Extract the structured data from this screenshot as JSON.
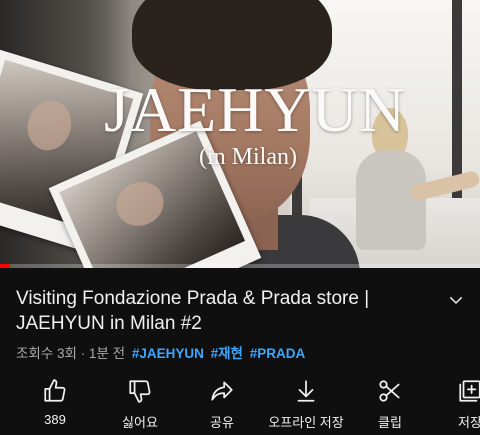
{
  "video": {
    "overlay_title": "JAEHYUN",
    "overlay_subtitle": "(in Milan)",
    "progress": 0.02,
    "progress_color": "#ff0000"
  },
  "info": {
    "title": "Visiting Fondazione Prada & Prada store | JAEHYUN in Milan #2",
    "meta_text": "조회수 3회 · 1분 전",
    "hashtags": [
      "#JAEHYUN",
      "#재현",
      "#PRADA"
    ],
    "hashtag_color": "#3ea6ff"
  },
  "actions": [
    {
      "icon": "thumbs-up-icon",
      "label": "389"
    },
    {
      "icon": "thumbs-down-icon",
      "label": "싫어요"
    },
    {
      "icon": "share-icon",
      "label": "공유"
    },
    {
      "icon": "download-icon",
      "label": "오프라인 저장"
    },
    {
      "icon": "scissors-icon",
      "label": "클립"
    },
    {
      "icon": "save-playlist-icon",
      "label": "저장"
    }
  ]
}
